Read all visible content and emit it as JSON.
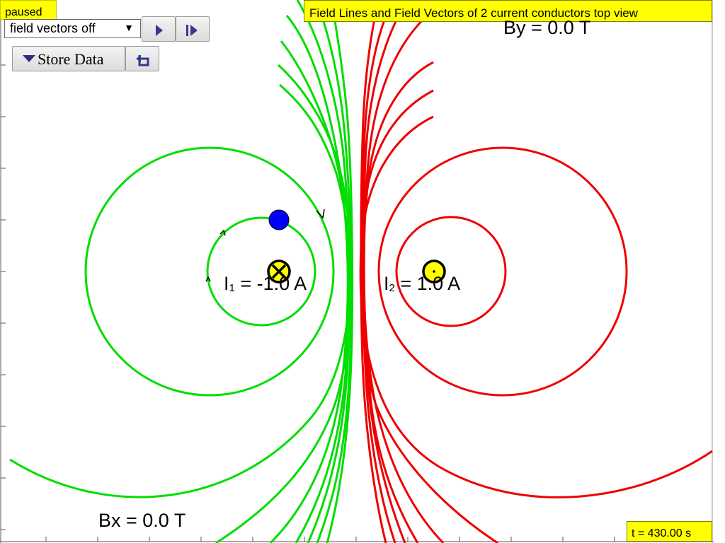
{
  "status": {
    "text": "paused"
  },
  "title": {
    "text": "Field Lines and Field Vectors of 2 current conductors top view"
  },
  "controls": {
    "mode_select_value": "field vectors off",
    "store_label": "Store Data",
    "play_icon": "play-icon",
    "step_icon": "step-forward-icon",
    "undo_icon": "undo-icon"
  },
  "readouts": {
    "by": "By = 0.0 T",
    "bx": "Bx = 0.0 T",
    "time": "t = 430.00 s"
  },
  "conductors": {
    "i1": {
      "symbol": "I",
      "sub": "1",
      "value": " = -1.0 A",
      "direction": "into-page"
    },
    "i2": {
      "symbol": "I",
      "sub": "2",
      "value": " = 1.0 A",
      "direction": "out-of-page"
    }
  },
  "colors": {
    "field_line_1": "#00dd00",
    "field_line_2": "#ee0000",
    "conductor_fill": "#ffff00",
    "probe": "#0000ff",
    "highlight": "#ffff00"
  }
}
